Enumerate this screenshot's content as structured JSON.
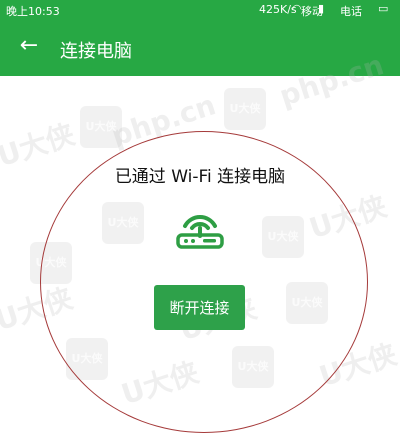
{
  "status_bar": {
    "time": "晚上10:53",
    "speed": "425K/s",
    "carrier": "移动",
    "battery": "电话"
  },
  "app_bar": {
    "title": "连接电脑"
  },
  "main": {
    "status_text": "已通过 Wi-Fi 连接电脑",
    "disconnect_label": "断开连接"
  },
  "watermarks": {
    "brand": "U大侠",
    "badge": "U大侠",
    "site": "php.cn"
  },
  "colors": {
    "accent": "#27a844",
    "button": "#2ea14a",
    "annotation_circle": "#a53a3a"
  }
}
